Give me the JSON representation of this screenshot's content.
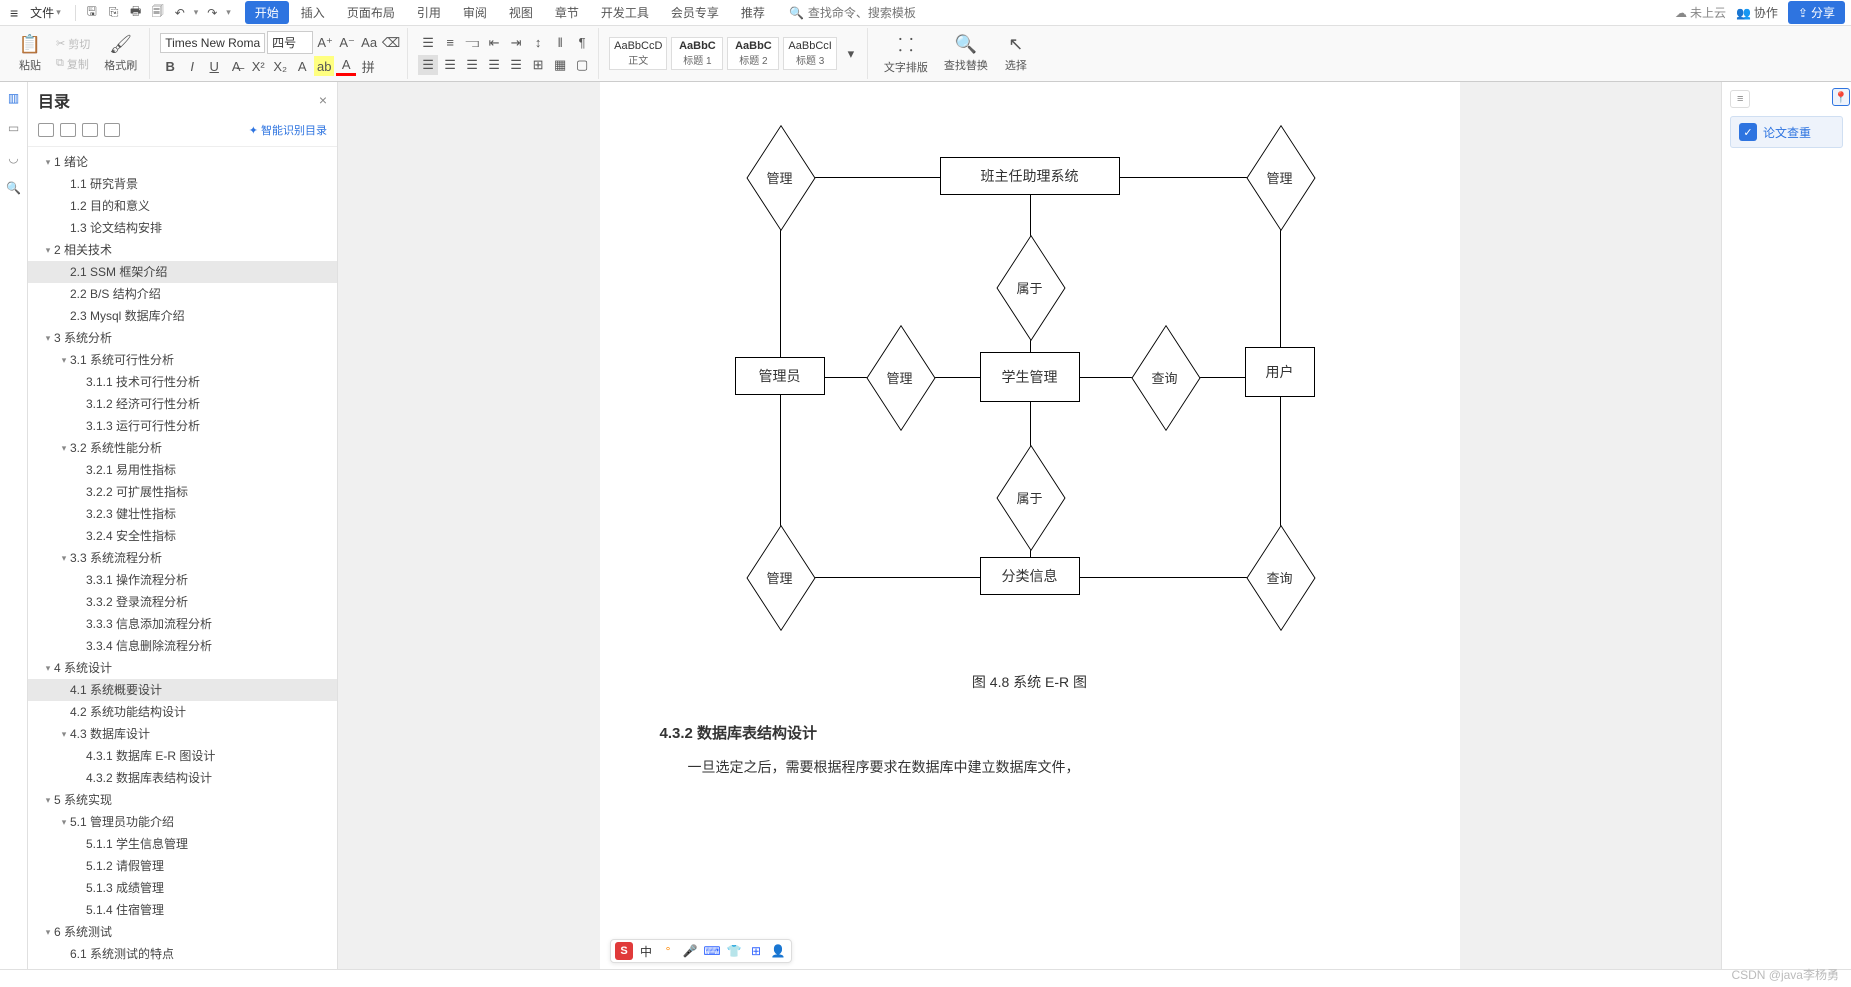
{
  "menubar": {
    "file": "文件",
    "search_placeholder": "查找命令、搜索模板",
    "tabs": [
      "开始",
      "插入",
      "页面布局",
      "引用",
      "审阅",
      "视图",
      "章节",
      "开发工具",
      "会员专享",
      "推荐"
    ],
    "cloud_status": "未上云",
    "collab": "协作",
    "share": "分享"
  },
  "ribbon": {
    "paste": "粘贴",
    "cut": "剪切",
    "copy": "复制",
    "format_painter": "格式刷",
    "font_name": "Times New Roma",
    "font_size": "四号",
    "styles": [
      {
        "sample": "AaBbCcD",
        "name": "正文"
      },
      {
        "sample": "AaBbC",
        "name": "标题 1"
      },
      {
        "sample": "AaBbC",
        "name": "标题 2"
      },
      {
        "sample": "AaBbCcI",
        "name": "标题 3"
      }
    ],
    "text_layout": "文字排版",
    "find_replace": "查找替换",
    "select": "选择"
  },
  "outline": {
    "title": "目录",
    "smart": "智能识别目录",
    "items": [
      {
        "level": 0,
        "caret": "▾",
        "label": "1  绪论"
      },
      {
        "level": 1,
        "caret": "",
        "label": "1.1  研究背景"
      },
      {
        "level": 1,
        "caret": "",
        "label": "1.2  目的和意义"
      },
      {
        "level": 1,
        "caret": "",
        "label": "1.3  论文结构安排"
      },
      {
        "level": 0,
        "caret": "▾",
        "label": "2  相关技术"
      },
      {
        "level": 1,
        "caret": "",
        "label": "2.1  SSM 框架介绍",
        "selected": true
      },
      {
        "level": 1,
        "caret": "",
        "label": "2.2  B/S 结构介绍"
      },
      {
        "level": 1,
        "caret": "",
        "label": "2.3  Mysql 数据库介绍"
      },
      {
        "level": 0,
        "caret": "▾",
        "label": "3  系统分析"
      },
      {
        "level": 1,
        "caret": "▾",
        "label": "3.1  系统可行性分析"
      },
      {
        "level": 2,
        "caret": "",
        "label": "3.1.1  技术可行性分析"
      },
      {
        "level": 2,
        "caret": "",
        "label": "3.1.2  经济可行性分析"
      },
      {
        "level": 2,
        "caret": "",
        "label": "3.1.3  运行可行性分析"
      },
      {
        "level": 1,
        "caret": "▾",
        "label": "3.2  系统性能分析"
      },
      {
        "level": 2,
        "caret": "",
        "label": "3.2.1  易用性指标"
      },
      {
        "level": 2,
        "caret": "",
        "label": "3.2.2  可扩展性指标"
      },
      {
        "level": 2,
        "caret": "",
        "label": "3.2.3  健壮性指标"
      },
      {
        "level": 2,
        "caret": "",
        "label": "3.2.4  安全性指标"
      },
      {
        "level": 1,
        "caret": "▾",
        "label": "3.3  系统流程分析"
      },
      {
        "level": 2,
        "caret": "",
        "label": "3.3.1  操作流程分析"
      },
      {
        "level": 2,
        "caret": "",
        "label": "3.3.2  登录流程分析"
      },
      {
        "level": 2,
        "caret": "",
        "label": "3.3.3  信息添加流程分析"
      },
      {
        "level": 2,
        "caret": "",
        "label": "3.3.4  信息删除流程分析"
      },
      {
        "level": 0,
        "caret": "▾",
        "label": "4  系统设计"
      },
      {
        "level": 1,
        "caret": "",
        "label": "4.1  系统概要设计",
        "selected": true
      },
      {
        "level": 1,
        "caret": "",
        "label": "4.2  系统功能结构设计"
      },
      {
        "level": 1,
        "caret": "▾",
        "label": "4.3  数据库设计"
      },
      {
        "level": 2,
        "caret": "",
        "label": "4.3.1  数据库 E-R 图设计"
      },
      {
        "level": 2,
        "caret": "",
        "label": "4.3.2  数据库表结构设计"
      },
      {
        "level": 0,
        "caret": "▾",
        "label": "5  系统实现"
      },
      {
        "level": 1,
        "caret": "▾",
        "label": "5.1  管理员功能介绍"
      },
      {
        "level": 2,
        "caret": "",
        "label": "5.1.1  学生信息管理"
      },
      {
        "level": 2,
        "caret": "",
        "label": "5.1.2  请假管理"
      },
      {
        "level": 2,
        "caret": "",
        "label": "5.1.3  成绩管理"
      },
      {
        "level": 2,
        "caret": "",
        "label": "5.1.4  住宿管理"
      },
      {
        "level": 0,
        "caret": "▾",
        "label": "6  系统测试"
      },
      {
        "level": 1,
        "caret": "",
        "label": "6.1  系统测试的特点"
      }
    ]
  },
  "doc": {
    "er": {
      "top_center": "班主任助理系统",
      "mid_left": "管理员",
      "mid_center": "学生管理",
      "mid_right": "用户",
      "bottom_center": "分类信息",
      "d_manage": "管理",
      "d_belong": "属于",
      "d_query": "查询"
    },
    "figure_caption": "图 4.8  系统 E-R 图",
    "section_heading": "4.3.2  数据库表结构设计",
    "body": "一旦选定之后，需要根据程序要求在数据库中建立数据库文件，"
  },
  "right": {
    "collapse": "≡",
    "paper_check": "论文查重"
  },
  "ime": {
    "logo": "S",
    "lang": "中"
  },
  "watermark": "CSDN @java李杨勇"
}
